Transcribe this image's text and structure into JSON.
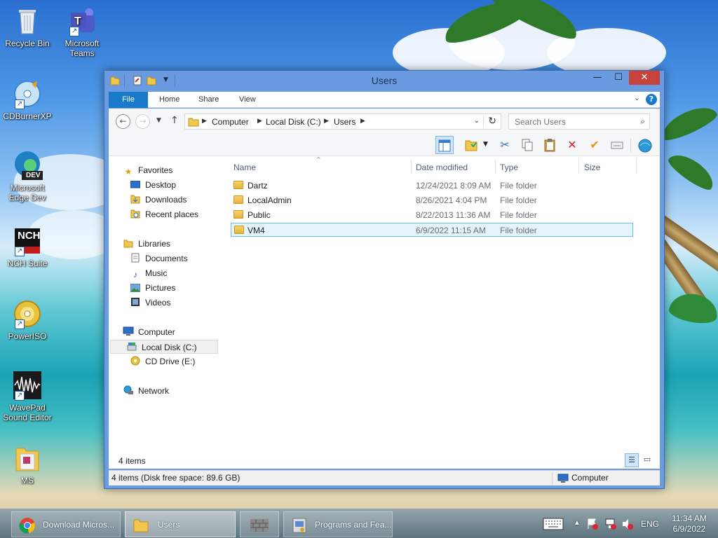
{
  "desktop": {
    "icons": [
      {
        "label": "Recycle Bin",
        "icon": "recycle-bin-icon"
      },
      {
        "label": "Microsoft Teams",
        "icon": "teams-icon"
      },
      {
        "label": "CDBurnerXP",
        "icon": "cdburnerxp-icon"
      },
      {
        "label": "Microsoft Edge Dev",
        "icon": "edge-dev-icon",
        "badge": "DEV"
      },
      {
        "label": "NCH Suite",
        "icon": "nch-icon",
        "badge": "NCH"
      },
      {
        "label": "PowerISO",
        "icon": "poweriso-icon"
      },
      {
        "label": "WavePad Sound Editor",
        "icon": "wavepad-icon"
      },
      {
        "label": "MS",
        "icon": "folder-icon"
      }
    ]
  },
  "window": {
    "title": "Users",
    "controls": {
      "minimize": "—",
      "maximize": "☐",
      "close": "✕"
    },
    "ribbon_tabs": [
      "File",
      "Home",
      "Share",
      "View"
    ],
    "help_label": "?",
    "address": {
      "crumbs": [
        "Computer",
        "Local Disk (C:)",
        "Users"
      ]
    },
    "search": {
      "placeholder": "Search Users"
    },
    "nav": {
      "favorites": {
        "label": "Favorites",
        "items": [
          "Desktop",
          "Downloads",
          "Recent places"
        ]
      },
      "libraries": {
        "label": "Libraries",
        "items": [
          "Documents",
          "Music",
          "Pictures",
          "Videos"
        ]
      },
      "computer": {
        "label": "Computer",
        "items": [
          "Local Disk (C:)",
          "CD Drive (E:)"
        ],
        "selected": "Local Disk (C:)"
      },
      "network": {
        "label": "Network"
      }
    },
    "columns": [
      "Name",
      "Date modified",
      "Type",
      "Size"
    ],
    "files": [
      {
        "name": "Dartz",
        "date": "12/24/2021 8:09 AM",
        "type": "File folder",
        "size": ""
      },
      {
        "name": "LocalAdmin",
        "date": "8/26/2021 4:04 PM",
        "type": "File folder",
        "size": ""
      },
      {
        "name": "Public",
        "date": "8/22/2013 11:36 AM",
        "type": "File folder",
        "size": ""
      },
      {
        "name": "VM4",
        "date": "6/9/2022 11:15 AM",
        "type": "File folder",
        "size": ""
      }
    ],
    "selected_file": "VM4",
    "items_count": "4 items",
    "status_left": "4 items (Disk free space: 89.6 GB)",
    "status_right": "Computer"
  },
  "taskbar": {
    "tasks": [
      {
        "label": "Download Micros...",
        "icon": "chrome-icon",
        "active": false
      },
      {
        "label": "Users",
        "icon": "folder-icon",
        "active": true
      },
      {
        "label": "",
        "icon": "wall-icon",
        "active": false
      },
      {
        "label": "Programs and Fea...",
        "icon": "programs-icon",
        "active": false
      }
    ],
    "language": "ENG",
    "time": "11:34 AM",
    "date": "6/9/2022"
  },
  "colors": {
    "accent": "#1979ca",
    "titlebar": "#6a9ae0",
    "close": "#c7423a",
    "selection": "#e5f3fb",
    "folder": "#e3b33a"
  }
}
